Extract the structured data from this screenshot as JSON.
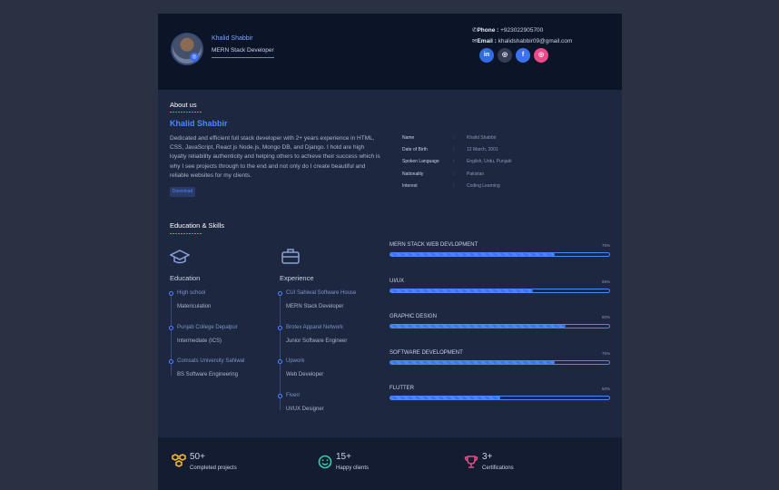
{
  "header": {
    "name": "Khalid Shabbir",
    "role": "MERN Stack Developer",
    "phone_label": "Phone :",
    "phone_value": "+923022905700",
    "email_label": "Email :",
    "email_value": "khalidshabbir09@gmail.com",
    "socials": [
      {
        "name": "linkedin",
        "glyph": "in",
        "color": "#2f6de0"
      },
      {
        "name": "github",
        "glyph": "◎",
        "color": "#343c56"
      },
      {
        "name": "facebook",
        "glyph": "f",
        "color": "#3b72f2"
      },
      {
        "name": "instagram",
        "glyph": "◎",
        "color": "#f0498a"
      }
    ]
  },
  "about": {
    "title": "About us",
    "name": "Khalid Shabbir",
    "text": "Dedicated and efficient full stack developer with 2+ years experience in HTML, CSS, JavaScript, React js Node.js, Mongo DB, and Django. I hold are high loyalty reliability authenticity and helping others to achieve their success which is why I see projects through to the end and not only do I create beautiful and reliable websites for my clients.",
    "download_label": "Download",
    "info": [
      {
        "key": "Name",
        "value": "Khalid Shabbir"
      },
      {
        "key": "Date of Birth",
        "value": "12 March, 2001"
      },
      {
        "key": "Spoken Language",
        "value": "English, Urdu, Punjabi"
      },
      {
        "key": "Nationality",
        "value": "Pakistan"
      },
      {
        "key": "Interest",
        "value": "Coding Learning"
      }
    ],
    "colon": ":"
  },
  "edu_skills": {
    "title": "Education & Skills",
    "education_title": "Education",
    "experience_title": "Experience",
    "education": [
      {
        "place": "High school",
        "detail": "Matericulation"
      },
      {
        "place": "Punjab College Depalpur",
        "detail": "Intermediate (ICS)"
      },
      {
        "place": "Comsats University Sahiwal",
        "detail": "BS Software Engineering"
      }
    ],
    "experience": [
      {
        "place": "CUI Sahiwal Software House",
        "detail": "MERN Stack Developer"
      },
      {
        "place": "Brotex Apparel Network",
        "detail": "Junior Software Engineer"
      },
      {
        "place": "Upwork",
        "detail": "Web Developer"
      },
      {
        "place": "Fiverr",
        "detail": "UI/UX Designer"
      }
    ],
    "skills": [
      {
        "name": "MERN STACK WEB DEVLOPMENT",
        "percent": 75,
        "pct_label": "75%"
      },
      {
        "name": "UI/UX",
        "percent": 65,
        "pct_label": "65%"
      },
      {
        "name": "GRAPHIC DESIGN",
        "percent": 80,
        "pct_label": "80%"
      },
      {
        "name": "SOFTWARE DEVELOPMENT",
        "percent": 75,
        "pct_label": "75%"
      },
      {
        "name": "FLUTTER",
        "percent": 50,
        "pct_label": "50%"
      }
    ]
  },
  "stats": [
    {
      "number": "50+",
      "label": "Completed projects",
      "icon": "hexagons-icon",
      "color": "#f2b233"
    },
    {
      "number": "15+",
      "label": "Happy clients",
      "icon": "smiley-icon",
      "color": "#2fd0b0"
    },
    {
      "number": "3+",
      "label": "Certifications",
      "icon": "trophy-icon",
      "color": "#f0498a"
    }
  ]
}
